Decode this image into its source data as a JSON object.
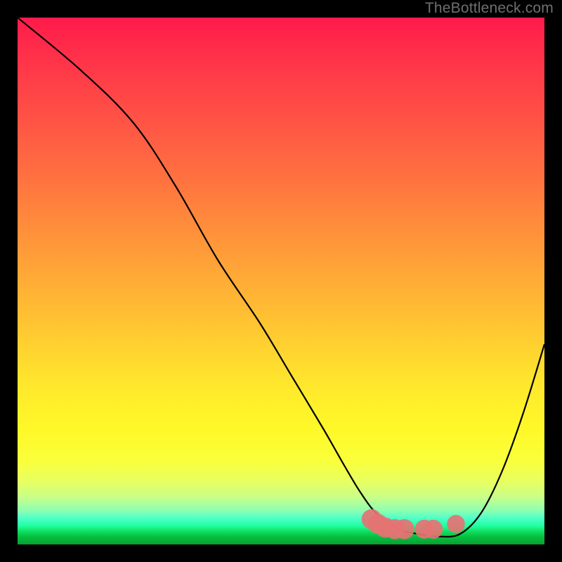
{
  "watermark": "TheBottleneck.com",
  "chart_data": {
    "type": "line",
    "title": "",
    "xlabel": "",
    "ylabel": "",
    "xlim": [
      0,
      100
    ],
    "ylim": [
      0,
      100
    ],
    "series": [
      {
        "name": "curve",
        "x": [
          0,
          12,
          22,
          30,
          38,
          46,
          52,
          58,
          62,
          65,
          68,
          72,
          76,
          80,
          84,
          88,
          92,
          96,
          100
        ],
        "values": [
          100,
          90,
          80,
          68,
          54,
          42,
          32,
          22,
          15,
          10,
          6,
          3,
          2,
          1.5,
          2,
          6,
          14,
          25,
          38
        ]
      }
    ],
    "markers": [
      {
        "x": 67.2,
        "y": 4.8,
        "size": 1.9
      },
      {
        "x": 68.4,
        "y": 3.9,
        "size": 1.9
      },
      {
        "x": 69.8,
        "y": 3.2,
        "size": 1.9
      },
      {
        "x": 71.6,
        "y": 2.9,
        "size": 1.9
      },
      {
        "x": 73.4,
        "y": 2.9,
        "size": 1.9
      },
      {
        "x": 77.2,
        "y": 2.9,
        "size": 1.8
      },
      {
        "x": 78.9,
        "y": 2.9,
        "size": 1.8
      },
      {
        "x": 83.2,
        "y": 3.9,
        "size": 1.7
      }
    ]
  }
}
